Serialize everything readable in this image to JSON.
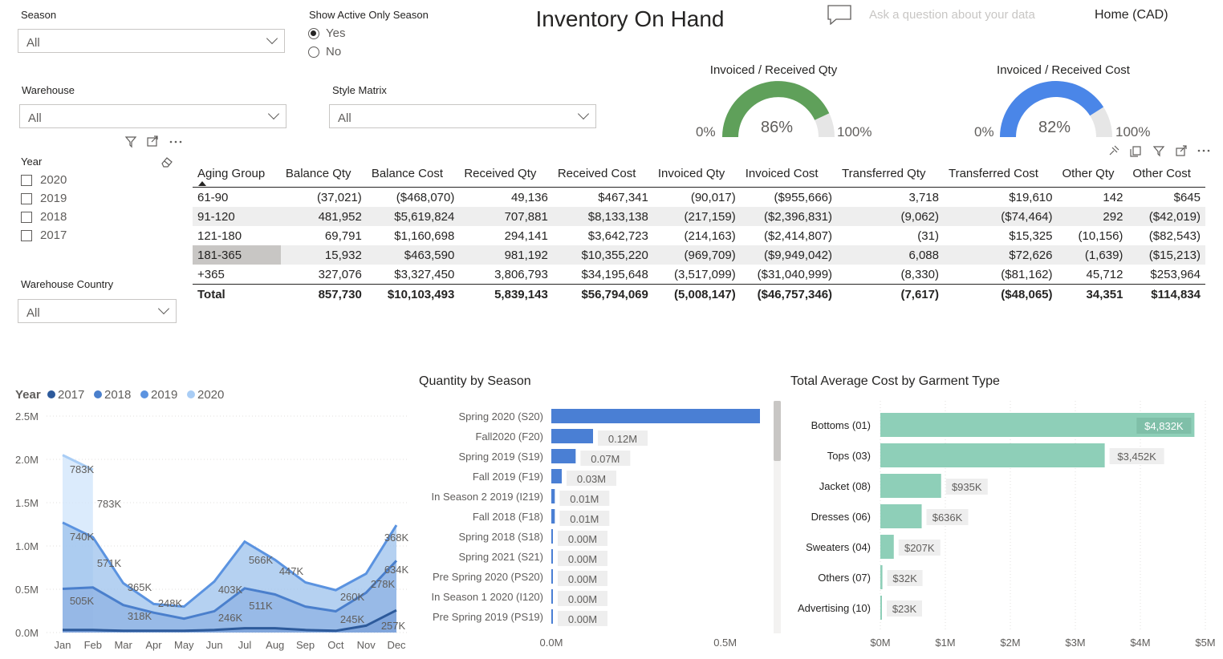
{
  "report": {
    "title": "Inventory On Hand",
    "qna_placeholder": "Ask a question about your data",
    "home_label": "Home (CAD)"
  },
  "slicers": {
    "season": {
      "title": "Season",
      "value": "All"
    },
    "active_only": {
      "title": "Show Active Only Season",
      "options": [
        "Yes",
        "No"
      ],
      "selected": "Yes"
    },
    "warehouse": {
      "title": "Warehouse",
      "value": "All"
    },
    "style_matrix": {
      "title": "Style Matrix",
      "value": "All"
    },
    "year": {
      "title": "Year",
      "options": [
        "2020",
        "2019",
        "2018",
        "2017"
      ]
    },
    "warehouse_country": {
      "title": "Warehouse Country",
      "value": "All"
    }
  },
  "gauges": [
    {
      "title": "Invoiced / Received Qty",
      "value": 86,
      "value_label": "86%",
      "min_label": "0%",
      "max_label": "100%",
      "color": "#5fa05a"
    },
    {
      "title": "Invoiced / Received Cost",
      "value": 82,
      "value_label": "82%",
      "min_label": "0%",
      "max_label": "100%",
      "color": "#4a86e8"
    }
  ],
  "matrix": {
    "columns": [
      "Aging Group",
      "Balance Qty",
      "Balance Cost",
      "Received Qty",
      "Received Cost",
      "Invoiced Qty",
      "Invoiced Cost",
      "Transferred Qty",
      "Transferred Cost",
      "Other Qty",
      "Other Cost"
    ],
    "rows": [
      [
        "61-90",
        "(37,021)",
        "($468,070)",
        "49,136",
        "$467,341",
        "(90,017)",
        "($955,666)",
        "3,718",
        "$19,610",
        "142",
        "$645"
      ],
      [
        "91-120",
        "481,952",
        "$5,619,824",
        "707,881",
        "$8,133,138",
        "(217,159)",
        "($2,396,831)",
        "(9,062)",
        "($74,464)",
        "292",
        "($42,019)"
      ],
      [
        "121-180",
        "69,791",
        "$1,160,698",
        "294,141",
        "$3,642,723",
        "(214,163)",
        "($2,414,807)",
        "(31)",
        "$15,325",
        "(10,156)",
        "($82,543)"
      ],
      [
        "181-365",
        "15,932",
        "$463,590",
        "981,192",
        "$10,355,220",
        "(969,709)",
        "($9,949,042)",
        "6,088",
        "$72,626",
        "(1,639)",
        "($15,213)"
      ],
      [
        "+365",
        "327,076",
        "$3,327,450",
        "3,806,793",
        "$34,195,648",
        "(3,517,099)",
        "($31,040,999)",
        "(8,330)",
        "($81,162)",
        "45,712",
        "$253,964"
      ]
    ],
    "total": [
      "Total",
      "857,730",
      "$10,103,493",
      "5,839,143",
      "$56,794,069",
      "(5,008,147)",
      "($46,757,346)",
      "(7,617)",
      "($48,065)",
      "34,351",
      "$114,834"
    ]
  },
  "chart_data": [
    {
      "type": "area",
      "legend_title": "Year",
      "legend_position": "top-left",
      "x": [
        "Jan",
        "Feb",
        "Mar",
        "Apr",
        "May",
        "Jun",
        "Jul",
        "Aug",
        "Sep",
        "Oct",
        "Nov",
        "Dec"
      ],
      "ylim": [
        0,
        2500000
      ],
      "yticks": [
        "0.0M",
        "0.5M",
        "1.0M",
        "1.5M",
        "2.0M",
        "2.5M"
      ],
      "grid": true,
      "series": [
        {
          "name": "2017",
          "color": "#2d5a9b",
          "values": [
            30000,
            30000,
            20000,
            20000,
            20000,
            30000,
            50000,
            50000,
            30000,
            20000,
            80000,
            257000
          ],
          "labels": []
        },
        {
          "name": "2018",
          "color": "#4a7fcc",
          "values": [
            505000,
            520000,
            318000,
            230000,
            160000,
            246000,
            511000,
            440000,
            300000,
            245000,
            460000,
            830000
          ],
          "labels": [
            [
              "Jan",
              "505K"
            ],
            [
              "Mar",
              "318K"
            ],
            [
              "Apr",
              "248K"
            ],
            [
              "Jun",
              "246K"
            ],
            [
              "Jul",
              "511K"
            ],
            [
              "Oct",
              "245K"
            ]
          ]
        },
        {
          "name": "2019",
          "color": "#5b93e0",
          "values": [
            1270000,
            1100000,
            570000,
            330000,
            300000,
            590000,
            1050000,
            840000,
            580000,
            490000,
            680000,
            1240000
          ],
          "labels": [
            [
              "Jan",
              "740K"
            ],
            [
              "Feb",
              "571K"
            ],
            [
              "Mar",
              "365K"
            ],
            [
              "Jun",
              "403K"
            ],
            [
              "Jul",
              "566K"
            ],
            [
              "Aug",
              "447K"
            ],
            [
              "Oct",
              "260K"
            ],
            [
              "Nov",
              "278K"
            ],
            [
              "Dec",
              "634K"
            ]
          ]
        },
        {
          "name": "2020",
          "color": "#a9cdf5",
          "values": [
            2050000,
            1880000
          ],
          "labels": [
            [
              "Jan",
              "783K"
            ],
            [
              "Feb",
              "783K"
            ],
            [
              "Dec",
              "368K"
            ]
          ]
        }
      ]
    },
    {
      "type": "bar",
      "orientation": "horizontal",
      "title": "Quantity by Season",
      "categories": [
        "Spring 2020 (S20)",
        "Fall2020 (F20)",
        "Spring 2019 (S19)",
        "Fall 2019 (F19)",
        "In Season 2 2019 (I219)",
        "Fall 2018 (F18)",
        "Spring 2018 (S18)",
        "Spring 2021 (S21)",
        "Pre Spring 2020 (PS20)",
        "In Season 1 2020 (I120)",
        "Pre Spring 2019 (PS19)"
      ],
      "values": [
        0.6,
        0.12,
        0.07,
        0.03,
        0.01,
        0.01,
        0.004,
        0.002,
        0.001,
        0.001,
        0.001
      ],
      "value_labels": [
        "",
        "0.12M",
        "0.07M",
        "0.03M",
        "0.01M",
        "0.01M",
        "0.00M",
        "0.00M",
        "0.00M",
        "0.00M",
        "0.00M"
      ],
      "xlim": [
        0,
        0.6
      ],
      "xticks": [
        "0.0M",
        "0.5M"
      ],
      "color": "#4a7fd4"
    },
    {
      "type": "bar",
      "orientation": "horizontal",
      "title": "Total Average Cost by Garment Type",
      "categories": [
        "Bottoms (01)",
        "Tops (03)",
        "Jacket (08)",
        "Dresses (06)",
        "Sweaters (04)",
        "Others (07)",
        "Advertising (10)"
      ],
      "values": [
        4832,
        3452,
        935,
        636,
        207,
        32,
        23
      ],
      "value_labels": [
        "$4,832K",
        "$3,452K",
        "$935K",
        "$636K",
        "$207K",
        "$32K",
        "$23K"
      ],
      "xlim": [
        0,
        5000
      ],
      "xticks": [
        "$0M",
        "$1M",
        "$2M",
        "$3M",
        "$4M",
        "$5M"
      ],
      "color": "#8ecfb8"
    }
  ]
}
